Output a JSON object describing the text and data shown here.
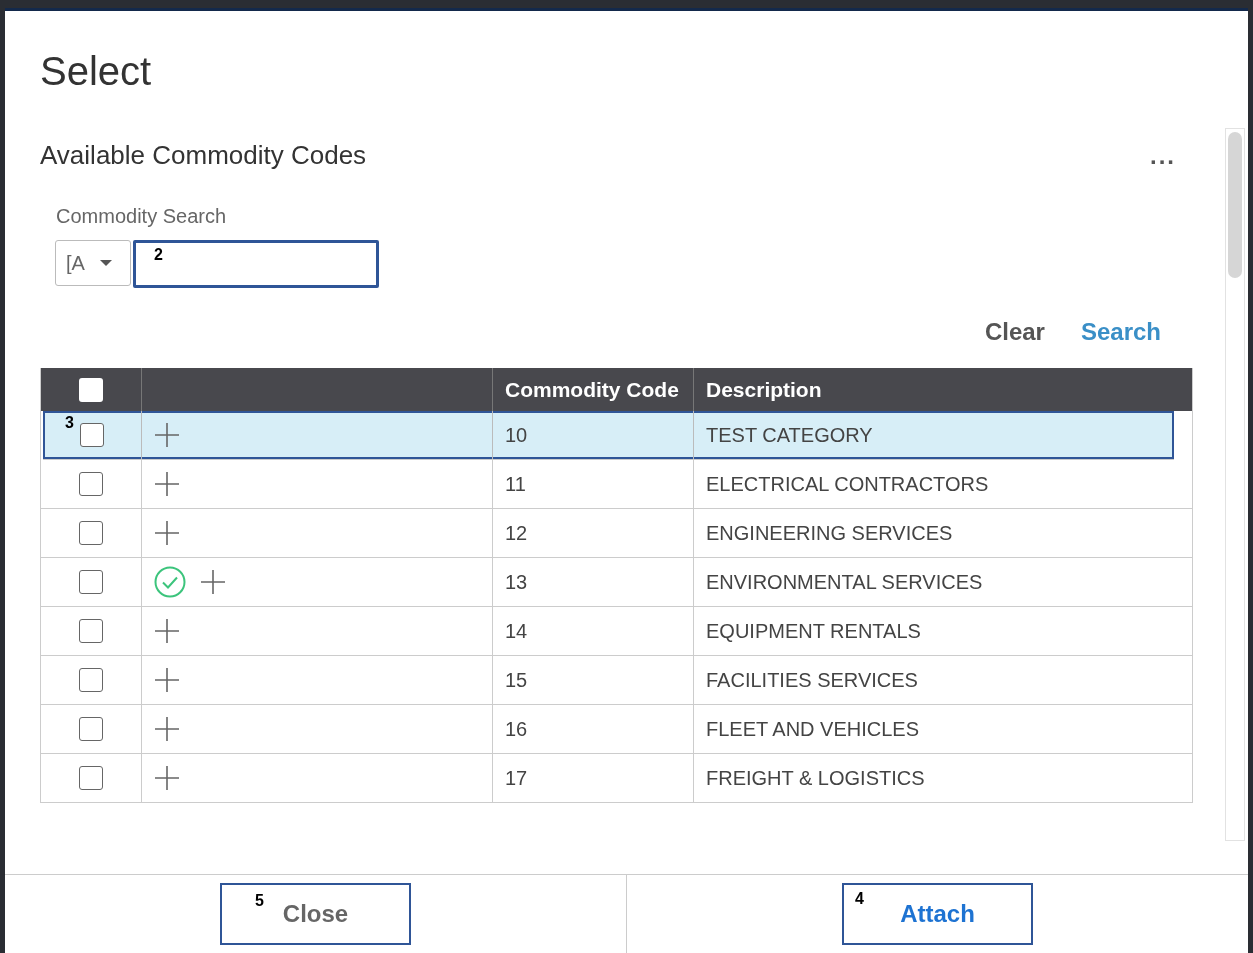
{
  "dialog": {
    "title": "Select"
  },
  "section": {
    "title": "Available Commodity Codes",
    "more_label": "..."
  },
  "search": {
    "label": "Commodity Search",
    "mode": "[A",
    "callout": "2"
  },
  "actions": [
    {
      "label": "Clear",
      "kind": "secondary"
    },
    {
      "label": "Search",
      "kind": "primary"
    }
  ],
  "table": {
    "columns": [
      "Commodity Code",
      "Description"
    ],
    "all_checked": false,
    "rows": [
      {
        "code": "10",
        "description": "TEST CATEGORY",
        "checked": false,
        "selected": true,
        "attached": false,
        "callout": "3"
      },
      {
        "code": "11",
        "description": "ELECTRICAL CONTRACTORS",
        "checked": false,
        "selected": false,
        "attached": false
      },
      {
        "code": "12",
        "description": "ENGINEERING SERVICES",
        "checked": false,
        "selected": false,
        "attached": false
      },
      {
        "code": "13",
        "description": "ENVIRONMENTAL SERVICES",
        "checked": false,
        "selected": false,
        "attached": true
      },
      {
        "code": "14",
        "description": "EQUIPMENT RENTALS",
        "checked": false,
        "selected": false,
        "attached": false
      },
      {
        "code": "15",
        "description": "FACILITIES SERVICES",
        "checked": false,
        "selected": false,
        "attached": false
      },
      {
        "code": "16",
        "description": "FLEET AND VEHICLES",
        "checked": false,
        "selected": false,
        "attached": false
      },
      {
        "code": "17",
        "description": "FREIGHT & LOGISTICS",
        "checked": false,
        "selected": false,
        "attached": false
      }
    ]
  },
  "footer": [
    {
      "label": "Close",
      "kind": "secondary",
      "callout": "5"
    },
    {
      "label": "Attach",
      "kind": "primary",
      "callout": "4"
    }
  ]
}
